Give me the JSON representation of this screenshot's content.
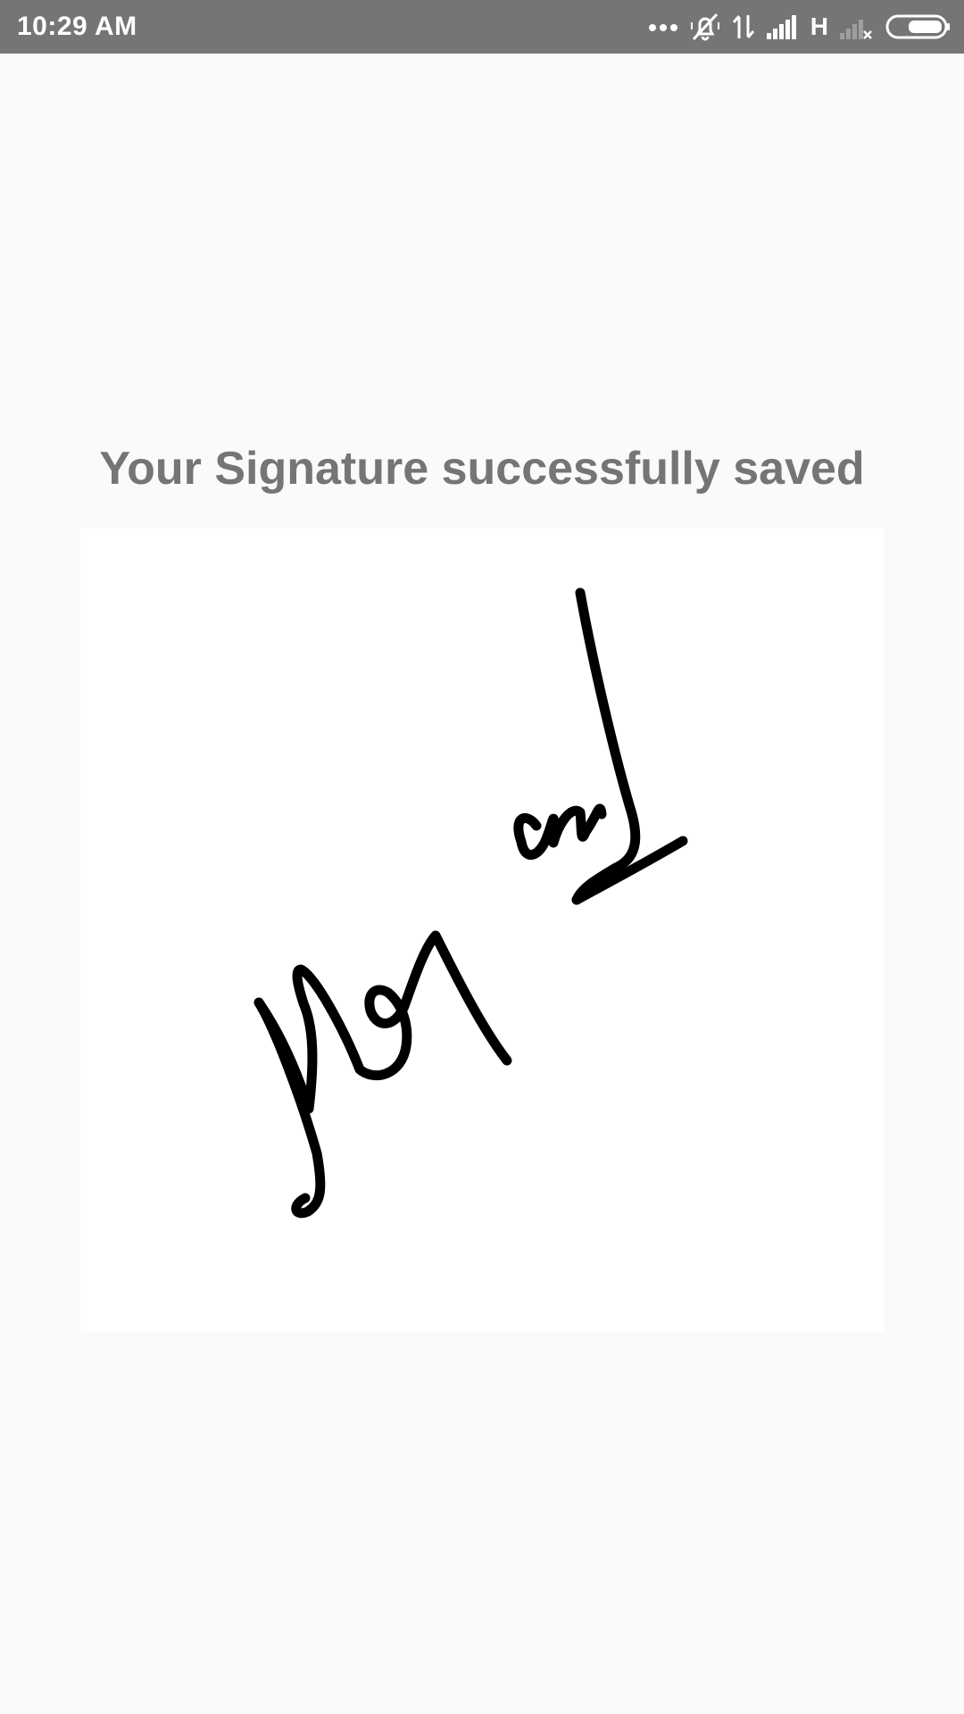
{
  "status_bar": {
    "time": "10:29 AM",
    "network_type": "H",
    "icons": [
      "more-dots-icon",
      "alarm-off-icon",
      "data-transfer-icon",
      "signal-icon",
      "no-signal-icon",
      "battery-icon"
    ]
  },
  "main": {
    "title": "Your Signature successfully saved"
  },
  "colors": {
    "status_bar_bg": "#757575",
    "page_bg": "#fafafa",
    "title_text": "#757575",
    "signature_card_bg": "#ffffff",
    "ink": "#000000"
  }
}
